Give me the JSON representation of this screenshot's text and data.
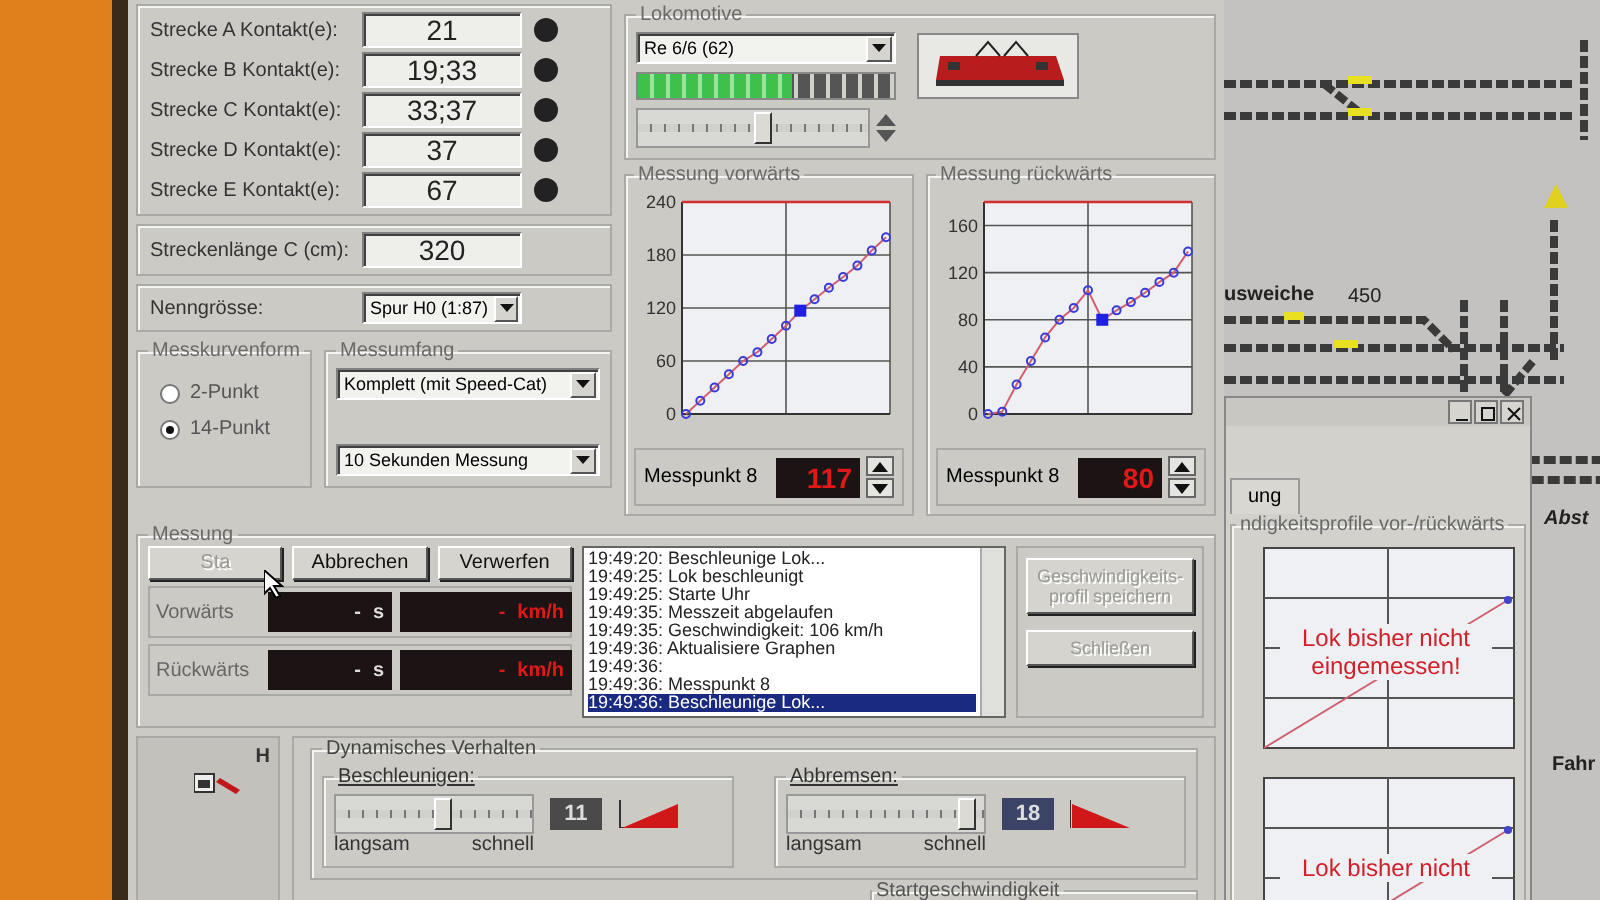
{
  "settings": {
    "contacts": [
      {
        "label": "Strecke A Kontakt(e):",
        "value": "21"
      },
      {
        "label": "Strecke B Kontakt(e):",
        "value": "19;33"
      },
      {
        "label": "Strecke C Kontakt(e):",
        "value": "33;37"
      },
      {
        "label": "Strecke D Kontakt(e):",
        "value": "37"
      },
      {
        "label": "Strecke E Kontakt(e):",
        "value": "67"
      }
    ],
    "track_length": {
      "label": "Streckenlänge C (cm):",
      "value": "320"
    },
    "scale": {
      "label": "Nenngrösse:",
      "value": "Spur H0 (1:87)"
    }
  },
  "curve_form": {
    "title": "Messkurvenform",
    "options": [
      {
        "label": "2-Punkt",
        "selected": false
      },
      {
        "label": "14-Punkt",
        "selected": true
      }
    ]
  },
  "scope": {
    "title": "Messumfang",
    "mode": "Komplett (mit Speed-Cat)",
    "duration": "10 Sekunden Messung"
  },
  "locomotive": {
    "title": "Lokomotive",
    "name": "Re 6/6 (62)",
    "meter": {
      "level": 0.6
    },
    "throttle": {
      "level": 0.55
    }
  },
  "measure_charts": [
    {
      "title": "Messung vorwärts",
      "point_label": "Messpunkt 8",
      "point_value": "117",
      "chart_data": {
        "type": "line",
        "categories": [
          null,
          null,
          null,
          null,
          null,
          null,
          null,
          null,
          null,
          null,
          null,
          null,
          null,
          null,
          null
        ],
        "ylim": [
          0,
          240
        ],
        "yticks": [
          0,
          60,
          120,
          180,
          240
        ],
        "grid": true,
        "series": [
          {
            "color": "#3b3bd8",
            "marker": "circle",
            "values": [
              0,
              15,
              30,
              45,
              60,
              70,
              85,
              100,
              117,
              130,
              143,
              155,
              168,
              185,
              200
            ]
          },
          {
            "color": "#2020e0",
            "marker": "square",
            "values": [
              null,
              null,
              null,
              null,
              null,
              null,
              null,
              null,
              117,
              null,
              null,
              null,
              null,
              null,
              null
            ]
          }
        ]
      }
    },
    {
      "title": "Messung rückwärts",
      "point_label": "Messpunkt 8",
      "point_value": "80",
      "chart_data": {
        "type": "line",
        "categories": [
          null,
          null,
          null,
          null,
          null,
          null,
          null,
          null,
          null,
          null,
          null,
          null,
          null,
          null,
          null
        ],
        "ylim": [
          0,
          180
        ],
        "yticks": [
          0,
          40,
          80,
          120,
          160
        ],
        "grid": true,
        "series": [
          {
            "color": "#3b3bd8",
            "marker": "circle",
            "values": [
              0,
              2,
              25,
              45,
              65,
              80,
              90,
              105,
              80,
              88,
              95,
              103,
              112,
              120,
              138
            ]
          },
          {
            "color": "#2020e0",
            "marker": "square",
            "values": [
              null,
              null,
              null,
              null,
              null,
              null,
              null,
              null,
              80,
              null,
              null,
              null,
              null,
              null,
              null
            ]
          }
        ]
      }
    }
  ],
  "measurement": {
    "title": "Messung",
    "buttons": [
      {
        "label": "Sta",
        "disabled": true
      },
      {
        "label": "Abbrechen",
        "disabled": false
      },
      {
        "label": "Verwerfen",
        "disabled": false
      }
    ],
    "rows": [
      {
        "label": "Vorwärts",
        "time": "-",
        "time_unit": "s",
        "speed": "-",
        "speed_unit": "km/h"
      },
      {
        "label": "Rückwärts",
        "time": "-",
        "time_unit": "s",
        "speed": "-",
        "speed_unit": "km/h"
      }
    ],
    "log": [
      {
        "text": "19:49:20: Beschleunige Lok...",
        "selected": false
      },
      {
        "text": "19:49:25: Lok beschleunigt",
        "selected": false
      },
      {
        "text": "19:49:25: Starte Uhr",
        "selected": false
      },
      {
        "text": "19:49:35: Messzeit abgelaufen",
        "selected": false
      },
      {
        "text": "19:49:35: Geschwindigkeit: 106 km/h",
        "selected": false
      },
      {
        "text": "19:49:36: Aktualisiere Graphen",
        "selected": false
      },
      {
        "text": "19:49:36:",
        "selected": false
      },
      {
        "text": "19:49:36: Messpunkt 8",
        "selected": false
      },
      {
        "text": "19:49:36: Beschleunige Lok...",
        "selected": true
      }
    ],
    "side_buttons": [
      {
        "label": "Geschwindigkeits-profil speichern",
        "disabled": true
      },
      {
        "label": "Schließen",
        "disabled": true
      }
    ]
  },
  "side_panel": {
    "text": "H"
  },
  "dynamics": {
    "title": "Dynamisches Verhalten",
    "controls": [
      {
        "kind": "accelerate",
        "label": "Beschleunigen:",
        "level": 0.55,
        "value": "11",
        "slow": "langsam",
        "fast": "schnell"
      },
      {
        "kind": "brake",
        "label": "Abbremsen:",
        "level": 0.95,
        "value": "18",
        "slow": "langsam",
        "fast": "schnell"
      }
    ],
    "next_group": "Startgeschwindigkeit"
  },
  "track_plan": {
    "labels": [
      "usweiche",
      "450",
      "Abst",
      "Fahr"
    ]
  },
  "profile_window": {
    "tab": "ung",
    "group": "ndigkeitsprofile vor-/rückwärts",
    "messages": [
      "Lok bisher nicht eingemessen!",
      "Lok bisher nicht"
    ]
  }
}
